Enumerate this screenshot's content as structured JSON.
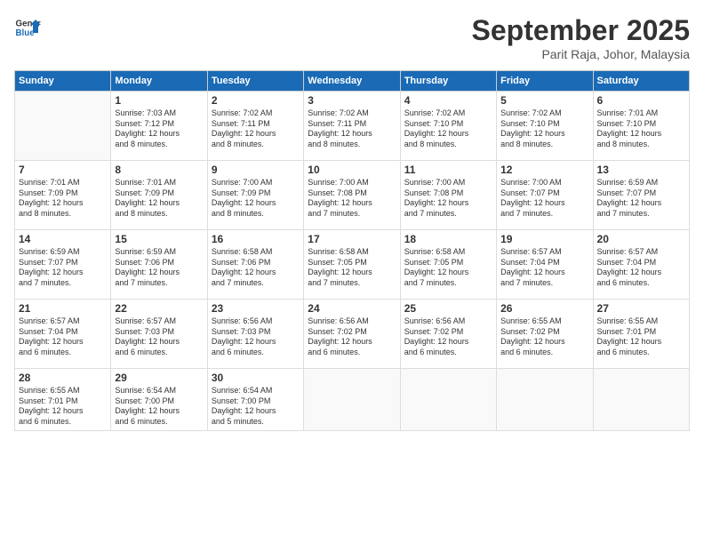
{
  "header": {
    "logo_line1": "General",
    "logo_line2": "Blue",
    "month": "September 2025",
    "location": "Parit Raja, Johor, Malaysia"
  },
  "days_of_week": [
    "Sunday",
    "Monday",
    "Tuesday",
    "Wednesday",
    "Thursday",
    "Friday",
    "Saturday"
  ],
  "weeks": [
    [
      {
        "day": "",
        "text": ""
      },
      {
        "day": "1",
        "text": "Sunrise: 7:03 AM\nSunset: 7:12 PM\nDaylight: 12 hours\nand 8 minutes."
      },
      {
        "day": "2",
        "text": "Sunrise: 7:02 AM\nSunset: 7:11 PM\nDaylight: 12 hours\nand 8 minutes."
      },
      {
        "day": "3",
        "text": "Sunrise: 7:02 AM\nSunset: 7:11 PM\nDaylight: 12 hours\nand 8 minutes."
      },
      {
        "day": "4",
        "text": "Sunrise: 7:02 AM\nSunset: 7:10 PM\nDaylight: 12 hours\nand 8 minutes."
      },
      {
        "day": "5",
        "text": "Sunrise: 7:02 AM\nSunset: 7:10 PM\nDaylight: 12 hours\nand 8 minutes."
      },
      {
        "day": "6",
        "text": "Sunrise: 7:01 AM\nSunset: 7:10 PM\nDaylight: 12 hours\nand 8 minutes."
      }
    ],
    [
      {
        "day": "7",
        "text": "Sunrise: 7:01 AM\nSunset: 7:09 PM\nDaylight: 12 hours\nand 8 minutes."
      },
      {
        "day": "8",
        "text": "Sunrise: 7:01 AM\nSunset: 7:09 PM\nDaylight: 12 hours\nand 8 minutes."
      },
      {
        "day": "9",
        "text": "Sunrise: 7:00 AM\nSunset: 7:09 PM\nDaylight: 12 hours\nand 8 minutes."
      },
      {
        "day": "10",
        "text": "Sunrise: 7:00 AM\nSunset: 7:08 PM\nDaylight: 12 hours\nand 7 minutes."
      },
      {
        "day": "11",
        "text": "Sunrise: 7:00 AM\nSunset: 7:08 PM\nDaylight: 12 hours\nand 7 minutes."
      },
      {
        "day": "12",
        "text": "Sunrise: 7:00 AM\nSunset: 7:07 PM\nDaylight: 12 hours\nand 7 minutes."
      },
      {
        "day": "13",
        "text": "Sunrise: 6:59 AM\nSunset: 7:07 PM\nDaylight: 12 hours\nand 7 minutes."
      }
    ],
    [
      {
        "day": "14",
        "text": "Sunrise: 6:59 AM\nSunset: 7:07 PM\nDaylight: 12 hours\nand 7 minutes."
      },
      {
        "day": "15",
        "text": "Sunrise: 6:59 AM\nSunset: 7:06 PM\nDaylight: 12 hours\nand 7 minutes."
      },
      {
        "day": "16",
        "text": "Sunrise: 6:58 AM\nSunset: 7:06 PM\nDaylight: 12 hours\nand 7 minutes."
      },
      {
        "day": "17",
        "text": "Sunrise: 6:58 AM\nSunset: 7:05 PM\nDaylight: 12 hours\nand 7 minutes."
      },
      {
        "day": "18",
        "text": "Sunrise: 6:58 AM\nSunset: 7:05 PM\nDaylight: 12 hours\nand 7 minutes."
      },
      {
        "day": "19",
        "text": "Sunrise: 6:57 AM\nSunset: 7:04 PM\nDaylight: 12 hours\nand 7 minutes."
      },
      {
        "day": "20",
        "text": "Sunrise: 6:57 AM\nSunset: 7:04 PM\nDaylight: 12 hours\nand 6 minutes."
      }
    ],
    [
      {
        "day": "21",
        "text": "Sunrise: 6:57 AM\nSunset: 7:04 PM\nDaylight: 12 hours\nand 6 minutes."
      },
      {
        "day": "22",
        "text": "Sunrise: 6:57 AM\nSunset: 7:03 PM\nDaylight: 12 hours\nand 6 minutes."
      },
      {
        "day": "23",
        "text": "Sunrise: 6:56 AM\nSunset: 7:03 PM\nDaylight: 12 hours\nand 6 minutes."
      },
      {
        "day": "24",
        "text": "Sunrise: 6:56 AM\nSunset: 7:02 PM\nDaylight: 12 hours\nand 6 minutes."
      },
      {
        "day": "25",
        "text": "Sunrise: 6:56 AM\nSunset: 7:02 PM\nDaylight: 12 hours\nand 6 minutes."
      },
      {
        "day": "26",
        "text": "Sunrise: 6:55 AM\nSunset: 7:02 PM\nDaylight: 12 hours\nand 6 minutes."
      },
      {
        "day": "27",
        "text": "Sunrise: 6:55 AM\nSunset: 7:01 PM\nDaylight: 12 hours\nand 6 minutes."
      }
    ],
    [
      {
        "day": "28",
        "text": "Sunrise: 6:55 AM\nSunset: 7:01 PM\nDaylight: 12 hours\nand 6 minutes."
      },
      {
        "day": "29",
        "text": "Sunrise: 6:54 AM\nSunset: 7:00 PM\nDaylight: 12 hours\nand 6 minutes."
      },
      {
        "day": "30",
        "text": "Sunrise: 6:54 AM\nSunset: 7:00 PM\nDaylight: 12 hours\nand 5 minutes."
      },
      {
        "day": "",
        "text": ""
      },
      {
        "day": "",
        "text": ""
      },
      {
        "day": "",
        "text": ""
      },
      {
        "day": "",
        "text": ""
      }
    ]
  ]
}
